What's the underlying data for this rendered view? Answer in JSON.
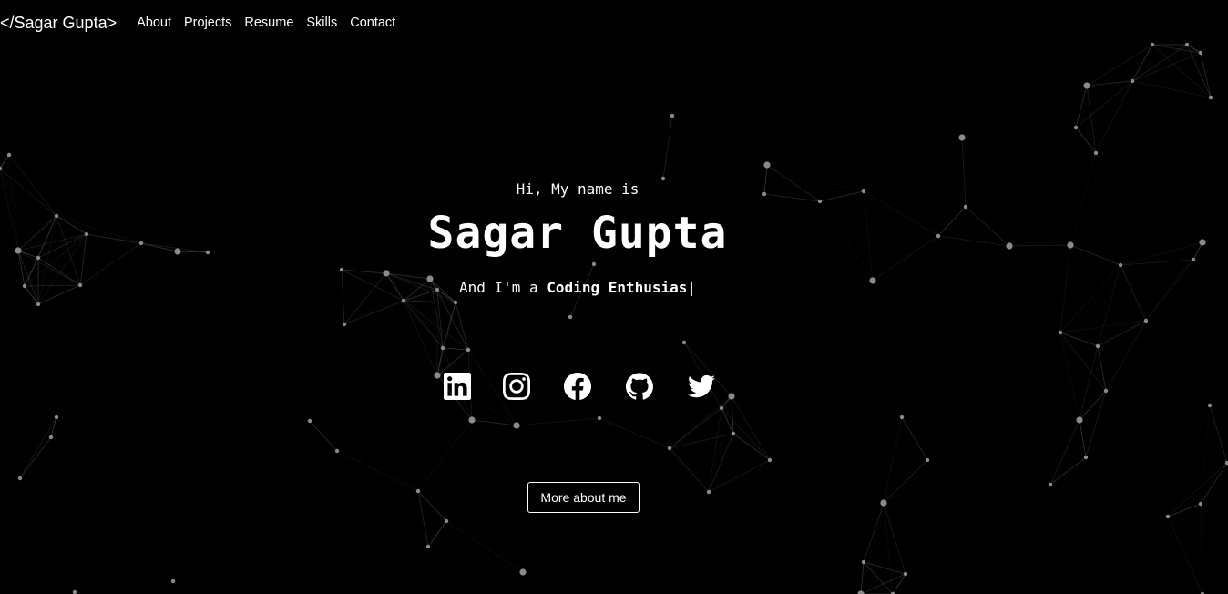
{
  "navbar": {
    "brand": "</Sagar Gupta>",
    "links": [
      "About",
      "Projects",
      "Resume",
      "Skills",
      "Contact"
    ]
  },
  "hero": {
    "greeting": "Hi, My name is",
    "name": "Sagar Gupta",
    "role_prefix": "And I'm a ",
    "role_typed": "Coding Enthusias",
    "cursor": "|",
    "cta_label": "More about me"
  },
  "socials": [
    {
      "name": "linkedin-icon"
    },
    {
      "name": "instagram-icon"
    },
    {
      "name": "facebook-icon"
    },
    {
      "name": "github-icon"
    },
    {
      "name": "twitter-icon"
    }
  ],
  "colors": {
    "background": "#000000",
    "foreground": "#ffffff",
    "particle": "#8a8a8a",
    "line": "#5a5a5a"
  }
}
